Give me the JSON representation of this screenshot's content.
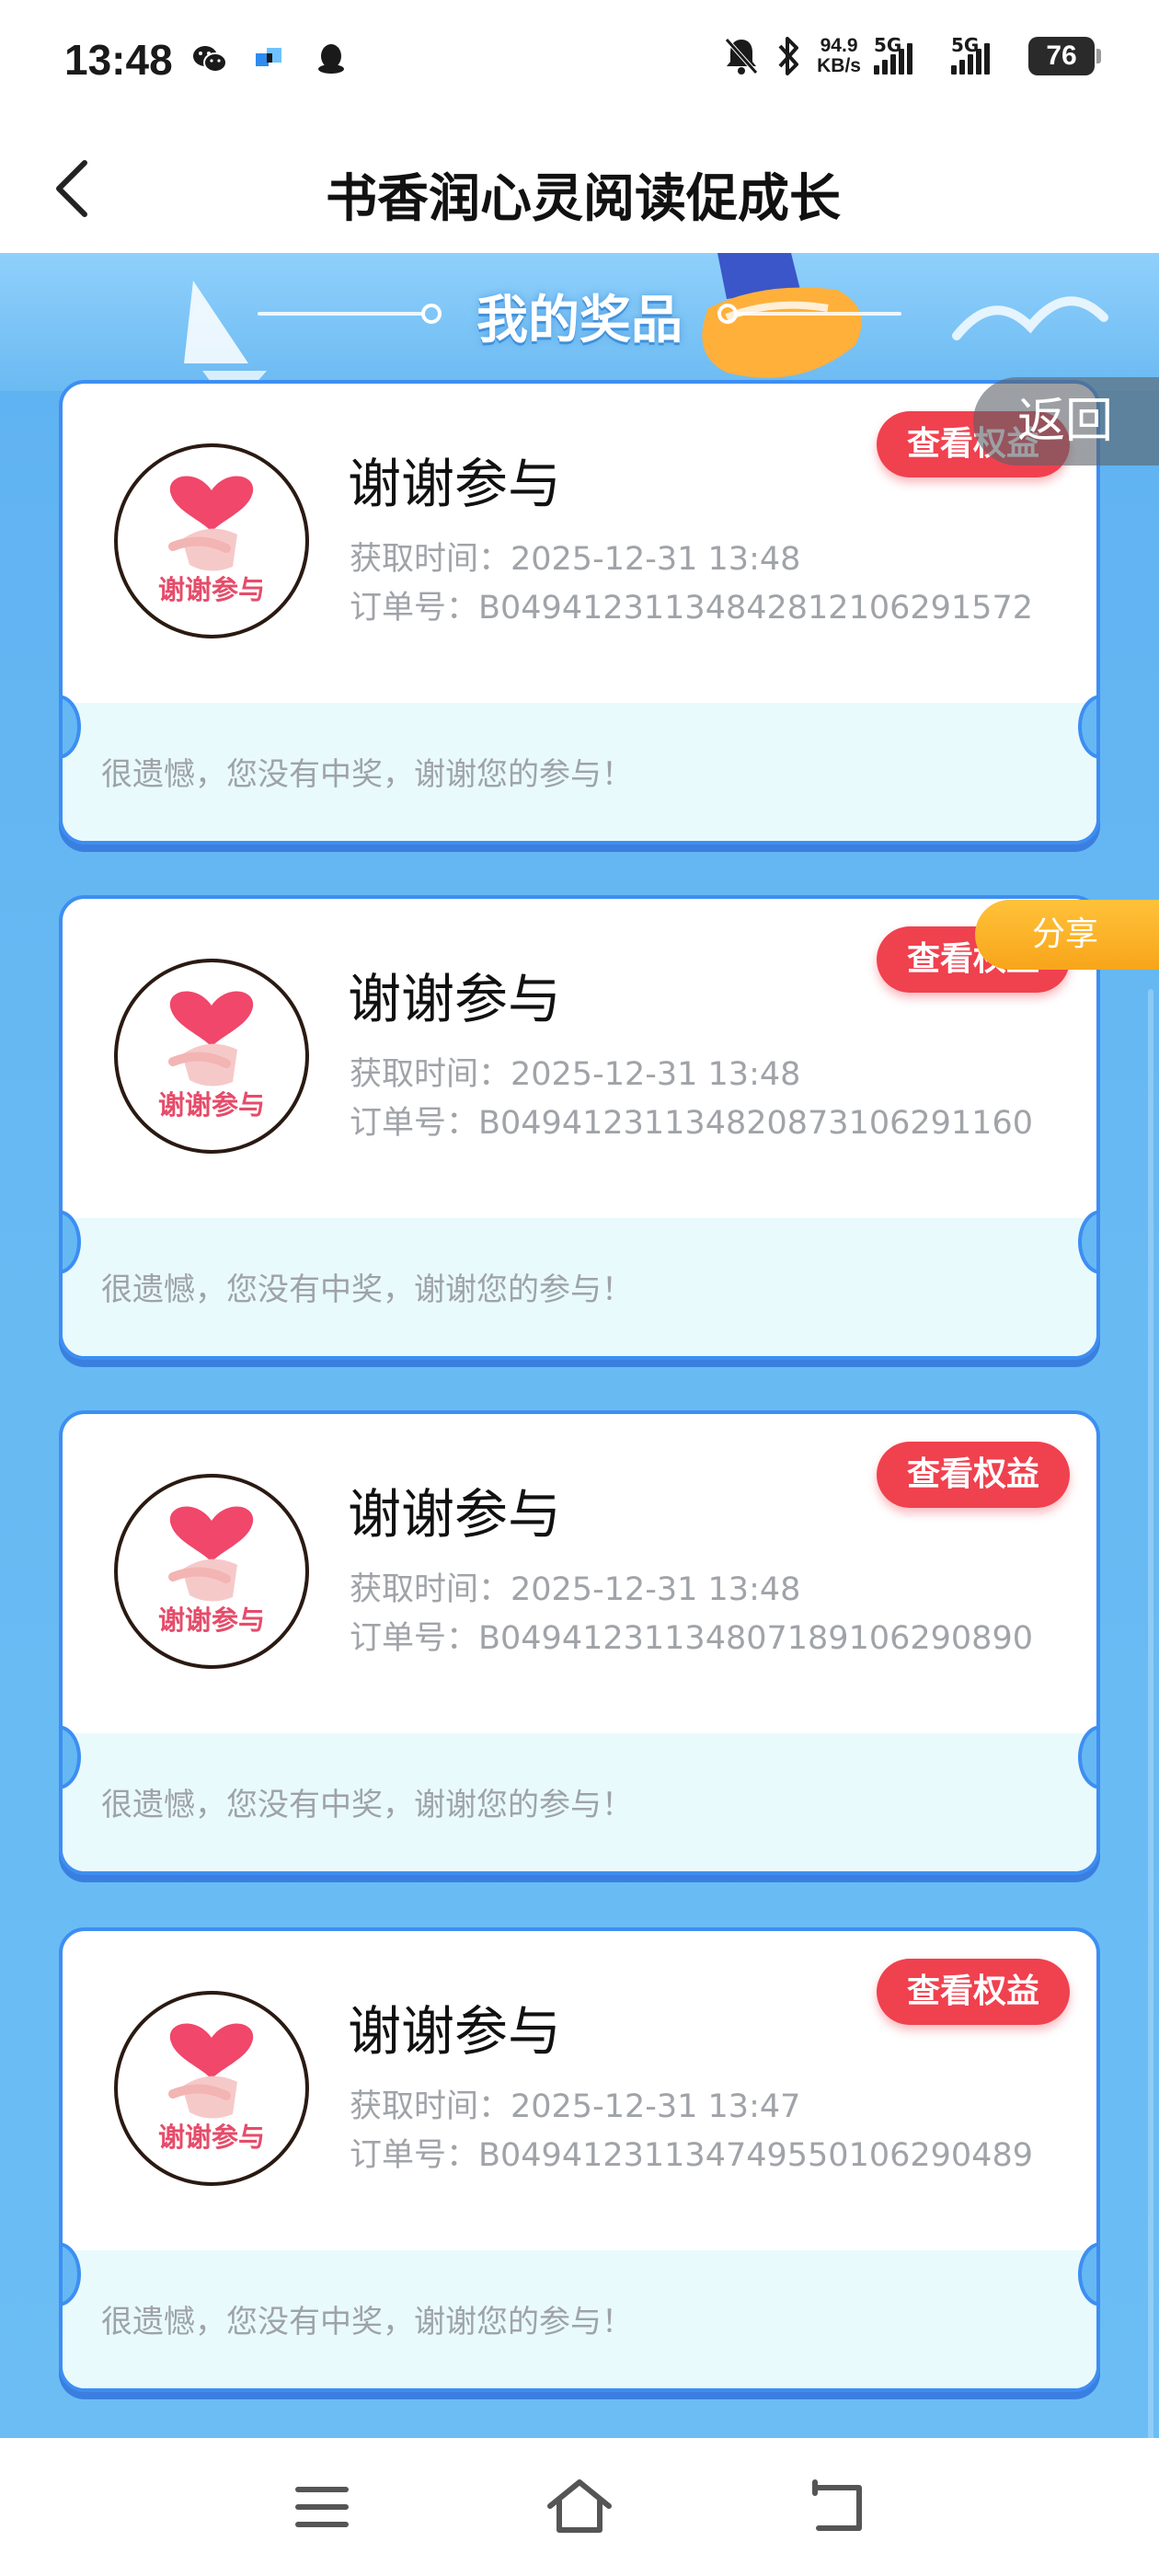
{
  "status_bar": {
    "time": "13:48",
    "net_speed_value": "94.9",
    "net_speed_unit": "KB/s",
    "sim1_label": "5G",
    "sim2_label": "5G",
    "battery": "76"
  },
  "header": {
    "title": "书香润心灵阅读促成长"
  },
  "banner": {
    "title": "我的奖品"
  },
  "prizes": [
    {
      "name": "谢谢参与",
      "time": "获取时间：2025-12-31 13:48",
      "order": "订单号：B04941231134842812106291572",
      "button": "查看权益",
      "note": "很遗憾，您没有中奖，谢谢您的参与！",
      "avatar_label": "谢谢参与"
    },
    {
      "name": "谢谢参与",
      "time": "获取时间：2025-12-31 13:48",
      "order": "订单号：B04941231134820873106291160",
      "button": "查看权益",
      "note": "很遗憾，您没有中奖，谢谢您的参与！",
      "avatar_label": "谢谢参与"
    },
    {
      "name": "谢谢参与",
      "time": "获取时间：2025-12-31 13:48",
      "order": "订单号：B04941231134807189106290890",
      "button": "查看权益",
      "note": "很遗憾，您没有中奖，谢谢您的参与！",
      "avatar_label": "谢谢参与"
    },
    {
      "name": "谢谢参与",
      "time": "获取时间：2025-12-31 13:47",
      "order": "订单号：B04941231134749550106290489",
      "button": "查看权益",
      "note": "很遗憾，您没有中奖，谢谢您的参与！",
      "avatar_label": "谢谢参与"
    }
  ],
  "floating": {
    "return_label": "返回",
    "share_label": "分享"
  },
  "nav_bar": {
    "menu_icon": "menu-icon",
    "home_icon": "home-icon",
    "back_icon": "back-icon"
  },
  "colors": {
    "accent_red": "#f0414f",
    "card_border": "#3d8ef2",
    "background_blue": "#66b8f3",
    "share_orange": "#f8a51a"
  }
}
